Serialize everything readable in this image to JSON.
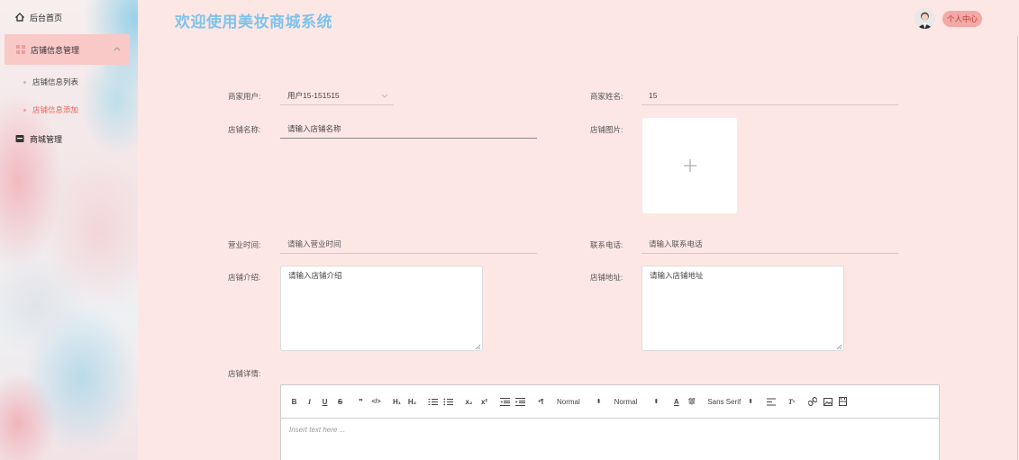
{
  "app": {
    "title": "欢迎使用美妆商城系统",
    "user_center": "个人中心"
  },
  "sidebar": {
    "home": "后台首页",
    "shop_info_mgmt": "店铺信息管理",
    "shop_info_list": "店铺信息列表",
    "shop_info_add": "店铺信息添加",
    "mall_mgmt": "商城管理"
  },
  "form": {
    "merchant_user_label": "商家用户:",
    "merchant_user_value": "用户15-151515",
    "merchant_name_label": "商家姓名:",
    "merchant_name_value": "15",
    "shop_name_label": "店铺名称:",
    "shop_name_placeholder": "请输入店铺名称",
    "shop_image_label": "店铺图片:",
    "business_hours_label": "营业时间:",
    "business_hours_placeholder": "请输入营业时间",
    "phone_label": "联系电话:",
    "phone_placeholder": "请输入联系电话",
    "intro_label": "店铺介绍:",
    "intro_placeholder": "请输入店铺介绍",
    "address_label": "店铺地址:",
    "address_placeholder": "请输入店铺地址",
    "details_label": "店铺详情:"
  },
  "editor": {
    "header_select": "Normal",
    "size_select": "Normal",
    "font_select": "Sans Serif",
    "placeholder": "Insert text here ..."
  },
  "colors": {
    "accent": "#7ec3ec",
    "active": "#e8685f",
    "background": "#fde7e4"
  }
}
